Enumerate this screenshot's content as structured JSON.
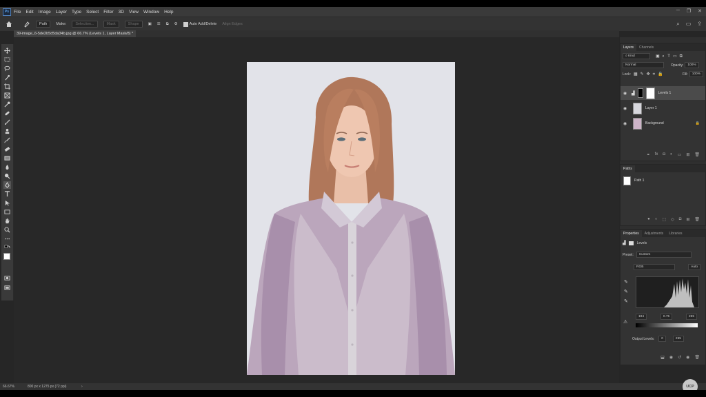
{
  "menu": {
    "logo": "Ps",
    "items": [
      "File",
      "Edit",
      "Image",
      "Layer",
      "Type",
      "Select",
      "Filter",
      "3D",
      "View",
      "Window",
      "Help"
    ]
  },
  "options": {
    "mode": "Path",
    "make_label": "Make:",
    "selection_btn": "Selection...",
    "mask_btn": "Mask",
    "shape_btn": "Shape",
    "auto_add_delete": "Auto Add/Delete",
    "align_edges": "Align Edges"
  },
  "document": {
    "tab_title": "39-image_6-5de2b5d5da34b.jpg @ 66.7% (Levels 1, Layer Mask/8) *"
  },
  "status": {
    "zoom": "66.67%",
    "doc_info": "800 px x 1275 px (72 ppi)",
    "arrow": "›"
  },
  "layers_panel": {
    "tabs": [
      "Layers",
      "Channels"
    ],
    "kind_filter": "Kind",
    "blend_mode": "Normal",
    "opacity_label": "Opacity:",
    "opacity_value": "100%",
    "lock_label": "Lock:",
    "fill_label": "Fill:",
    "fill_value": "100%",
    "layers": [
      {
        "name": "Levels 1",
        "selected": true
      },
      {
        "name": "Layer 1",
        "selected": false
      },
      {
        "name": "Background",
        "selected": false
      }
    ]
  },
  "paths_panel": {
    "tab": "Paths",
    "paths": [
      "Path 1"
    ]
  },
  "properties_panel": {
    "tabs": [
      "Properties",
      "Adjustments",
      "Libraries"
    ],
    "title": "Levels",
    "preset_label": "Preset:",
    "preset_value": "Custom",
    "channel": "RGB",
    "auto_btn": "Auto",
    "input_black": "194",
    "input_gamma": "0.75",
    "input_white": "255",
    "output_label": "Output Levels:",
    "output_black": "0",
    "output_white": "255"
  },
  "watermark": "UCP",
  "colors": {
    "app_bg": "#262626",
    "panel_bg": "#333333",
    "accent": "#4d7db8"
  }
}
